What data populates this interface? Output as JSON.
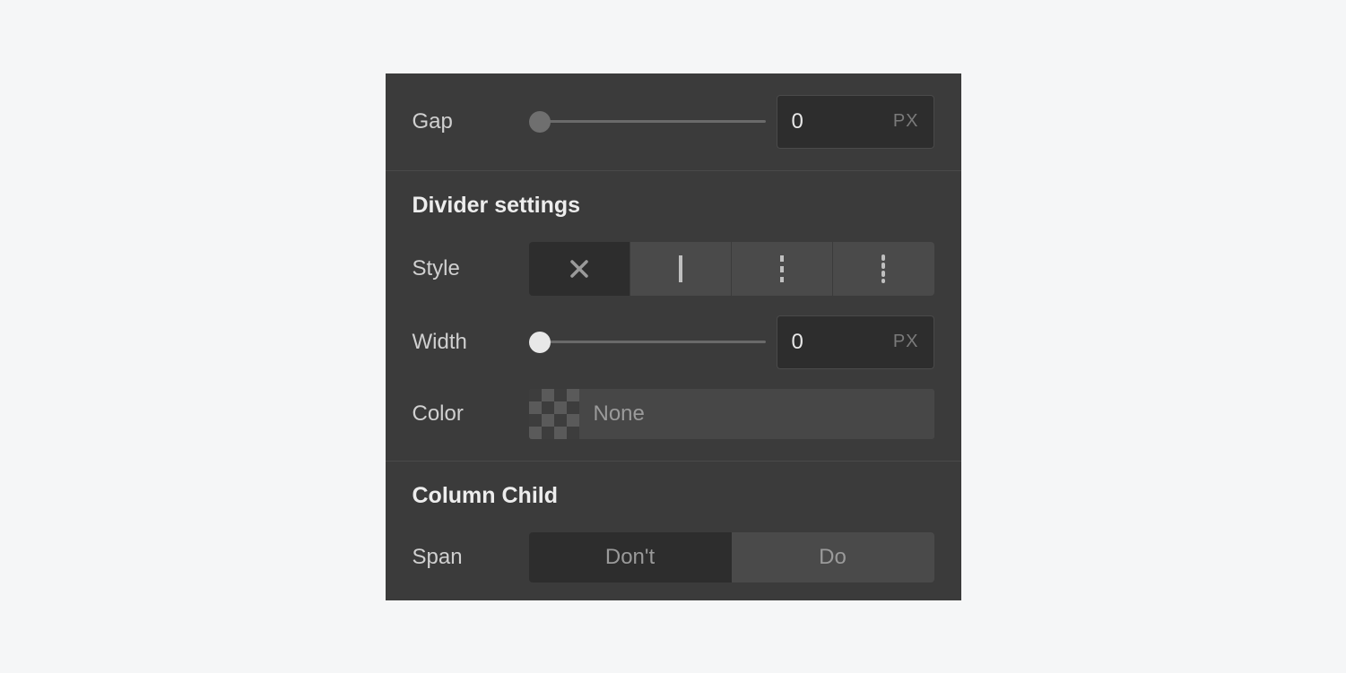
{
  "gap": {
    "label": "Gap",
    "value": "0",
    "unit": "PX"
  },
  "divider": {
    "title": "Divider settings",
    "style_label": "Style",
    "style_options": [
      "none",
      "solid",
      "dashed",
      "dotted"
    ],
    "style_selected": "none",
    "width_label": "Width",
    "width_value": "0",
    "width_unit": "PX",
    "color_label": "Color",
    "color_value": "None"
  },
  "column_child": {
    "title": "Column Child",
    "span_label": "Span",
    "span_options": {
      "dont": "Don't",
      "do": "Do"
    },
    "span_selected": "dont"
  }
}
